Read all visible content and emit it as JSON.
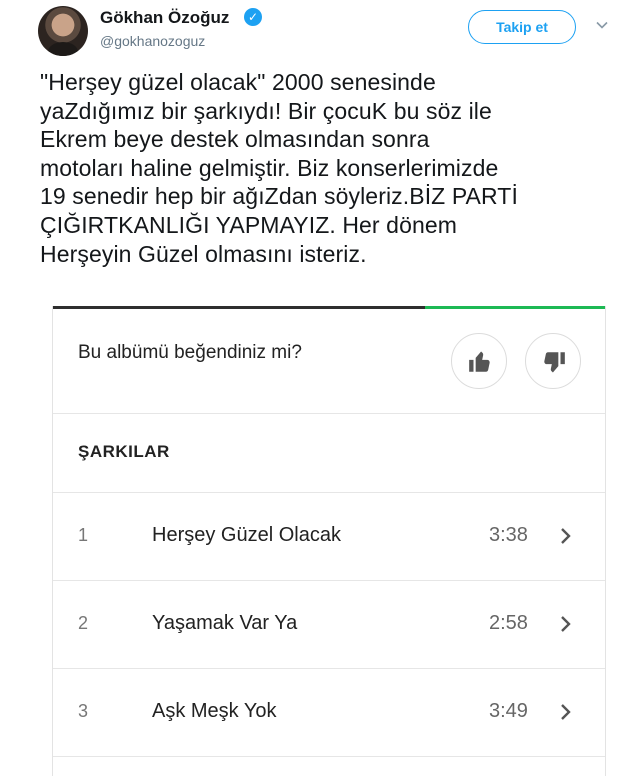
{
  "tweet": {
    "display_name": "Gökhan Özoğuz",
    "handle": "@gokhanozoguz",
    "verified_icon": "verified-badge-icon",
    "follow_label": "Takip et",
    "menu_icon": "chevron-down-icon",
    "text_lines": [
      "\"Herşey güzel olacak\" 2000 senesinde",
      "yaZdığımız bir şarkıydı! Bir çocuK bu söz ile",
      "Ekrem beye destek olmasından sonra",
      "motoları haline gelmiştir. Biz konserlerimizde",
      "19 senedir hep bir ağıZdan söyleriz.BİZ PARTİ",
      "ÇIĞIRTKANLIĞI YAPMAYIZ. Her dönem",
      "Herşeyin Güzel olmasını isteriz."
    ]
  },
  "album_card": {
    "question": "Bu albümü beğendiniz mi?",
    "like_icon": "thumbs-up-icon",
    "dislike_icon": "thumbs-down-icon",
    "section_title": "ŞARKILAR",
    "tracks": [
      {
        "number": "1",
        "title": "Herşey Güzel Olacak",
        "duration": "3:38"
      },
      {
        "number": "2",
        "title": "Yaşamak Var Ya",
        "duration": "2:58"
      },
      {
        "number": "3",
        "title": "Aşk Meşk Yok",
        "duration": "3:49"
      }
    ],
    "accent_color": "#1db954"
  },
  "colors": {
    "twitter_blue": "#1da1f2",
    "text": "#14171a",
    "muted": "#657786"
  }
}
